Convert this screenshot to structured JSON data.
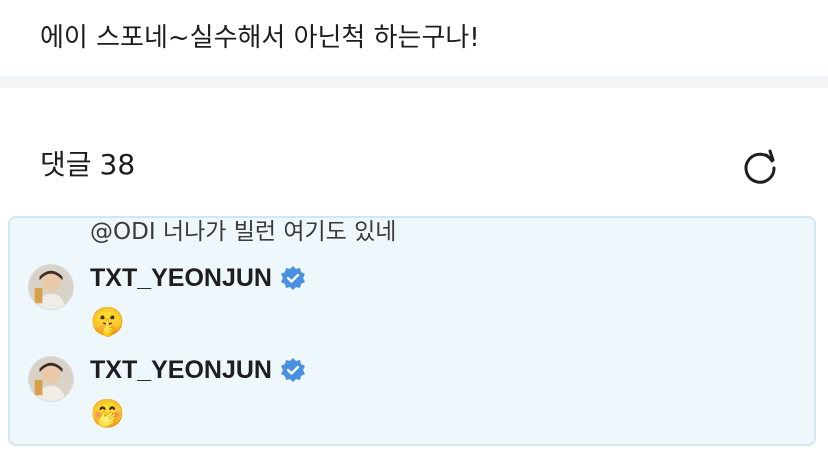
{
  "post": {
    "text": "에이 스포네~실수해서 아닌척 하는구나!"
  },
  "comments_section": {
    "title": "댓글",
    "count": "38",
    "refresh_icon": "refresh-icon"
  },
  "reply_preview": "@ODI 너나가 빌런 여기도 있네",
  "comments": [
    {
      "author": "TXT_YEONJUN",
      "verified": true,
      "body": "🤫",
      "avatar_icon": "avatar"
    },
    {
      "author": "TXT_YEONJUN",
      "verified": true,
      "body": "🤭",
      "avatar_icon": "avatar"
    }
  ],
  "colors": {
    "panel_bg": "#eef7fc",
    "panel_border": "#cfe6f3",
    "verified_badge": "#4a90e2",
    "divider": "#f4f5f7"
  }
}
